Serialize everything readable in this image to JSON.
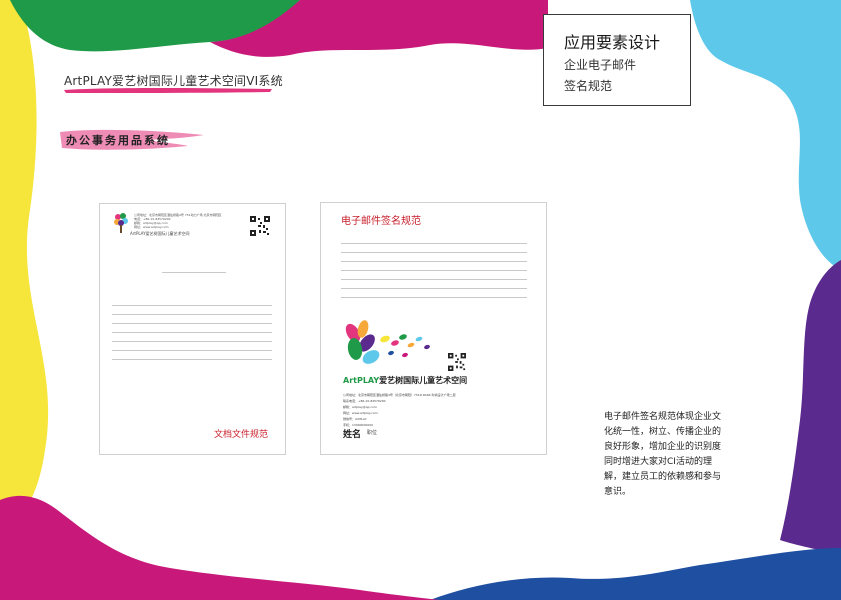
{
  "brand": {
    "title": "ArtPLAY爱艺树国际儿童艺术空间VI系统"
  },
  "section": {
    "label": "办公事务用品系统"
  },
  "title_box": {
    "heading": "应用要素设计",
    "line1": "企业电子邮件",
    "line2": "签名规范"
  },
  "doc_card": {
    "label": "文档文件规范",
    "header_line1": "公司地址：北京市朝阳区酒仙桥路4号 751动力广场  北京市朝阳区",
    "header_line2": "电话：+86-10-84576290",
    "header_line3": "邮箱：artplay@qq.com",
    "header_line4": "网址：www.artplay.com",
    "logo_text": "ArtPLAY爱艺树国际儿童艺术空间"
  },
  "sig_card": {
    "title": "电子邮件签名规范",
    "brand_art": "ArtPLAY",
    "brand_cn": "爱艺树国际儿童艺术空间",
    "contact": [
      "公司地址：北京市朝阳区酒仙桥路4号（北京市朝阳）751D·PARK 时尚设计广场二层",
      "联系电话：+86-10-84576290",
      "邮箱：artplay@qq.com",
      "网址：www.artplay.com",
      "微信号：ArtPLAY",
      "手机：13900000000"
    ],
    "name_label": "姓名",
    "role_label": "职位"
  },
  "description": "电子邮件签名规范体现企业文化统一性，树立、传播企业的良好形象，增加企业的识别度同时增进大家对CI活动的理解，建立员工的依赖感和参与意识。",
  "colors": {
    "yellow": "#f6e53a",
    "green": "#1f9a48",
    "magenta": "#c8197a",
    "cyan": "#5ec8ea",
    "purple": "#5b2a8e",
    "navy": "#1e4fa0",
    "pink": "#e2357e",
    "red_text": "#c8202c"
  }
}
